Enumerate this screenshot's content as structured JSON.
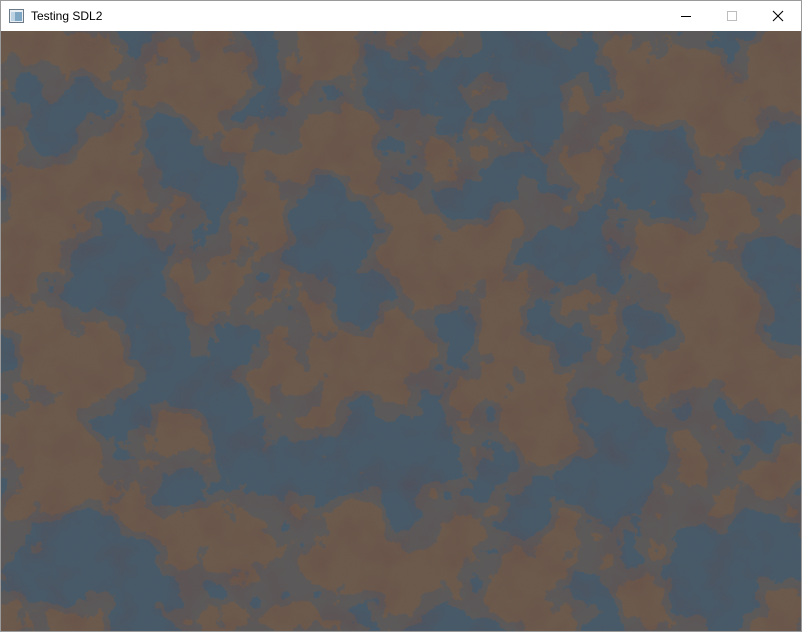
{
  "window": {
    "title": "Testing SDL2",
    "controls": {
      "minimize": "minimize-icon",
      "maximize": "maximize-icon",
      "close": "close-icon"
    }
  },
  "canvas": {
    "description_colors": {
      "cool": "#465a6b",
      "warm": "#6f5a4a",
      "deep_warm": "#6a4a48",
      "mid": "#5e6258"
    }
  }
}
